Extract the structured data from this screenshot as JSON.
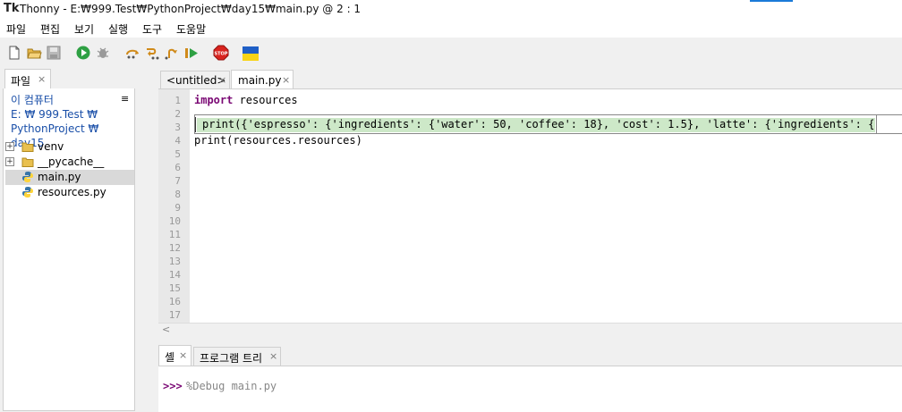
{
  "window": {
    "app_icon": "Tk",
    "title": "Thonny  -  E:₩999.Test₩PythonProject₩day15₩main.py  @  2 : 1"
  },
  "menu": {
    "items": [
      "파일",
      "편집",
      "보기",
      "실행",
      "도구",
      "도움말"
    ]
  },
  "toolbar": {
    "buttons": [
      "new-file-icon",
      "open-folder-icon",
      "save-icon",
      "run-icon",
      "debug-icon",
      "step-over-icon",
      "step-into-icon",
      "step-out-icon",
      "resume-icon",
      "stop-icon",
      "ukraine-flag-icon"
    ],
    "stop_label": "STOP"
  },
  "files_panel": {
    "tab_label": "파일",
    "tab_close": "×",
    "path": "이 컴퓨터\nE: ₩ 999.Test ₩\nPythonProject ₩ day15",
    "menu_glyph": "≡",
    "items": [
      {
        "name": "venv",
        "type": "folder",
        "expander": "+"
      },
      {
        "name": "__pycache__",
        "type": "folder",
        "expander": "+"
      },
      {
        "name": "main.py",
        "type": "python",
        "selected": true
      },
      {
        "name": "resources.py",
        "type": "python"
      }
    ]
  },
  "editor": {
    "tabs": [
      {
        "label": "<untitled>",
        "close": "×"
      },
      {
        "label": "main.py",
        "close": "×",
        "active": true
      }
    ],
    "line_numbers": [
      "1",
      "2",
      "3",
      "4",
      "5",
      "6",
      "7",
      "8",
      "9",
      "10",
      "11",
      "12",
      "13",
      "14",
      "15",
      "16",
      "17"
    ],
    "lines": {
      "l1_kw": "import",
      "l1_rest": " resources",
      "l4": "print(resources.resources)"
    },
    "hscroll_arrow": "<",
    "popup_text": "print({'espresso': {'ingredients': {'water': 50, 'coffee': 18}, 'cost': 1.5}, 'latte': {'ingredients': {'…)"
  },
  "shell": {
    "tabs": [
      {
        "label": "셸",
        "close": "×",
        "active": true
      },
      {
        "label": "프로그램 트리",
        "close": "×"
      }
    ],
    "prompt": ">>>",
    "command": "%Debug main.py"
  },
  "colors": {
    "keyword": "#7a0874",
    "link": "#1a4fa8",
    "highlight": "#cde8c8"
  }
}
